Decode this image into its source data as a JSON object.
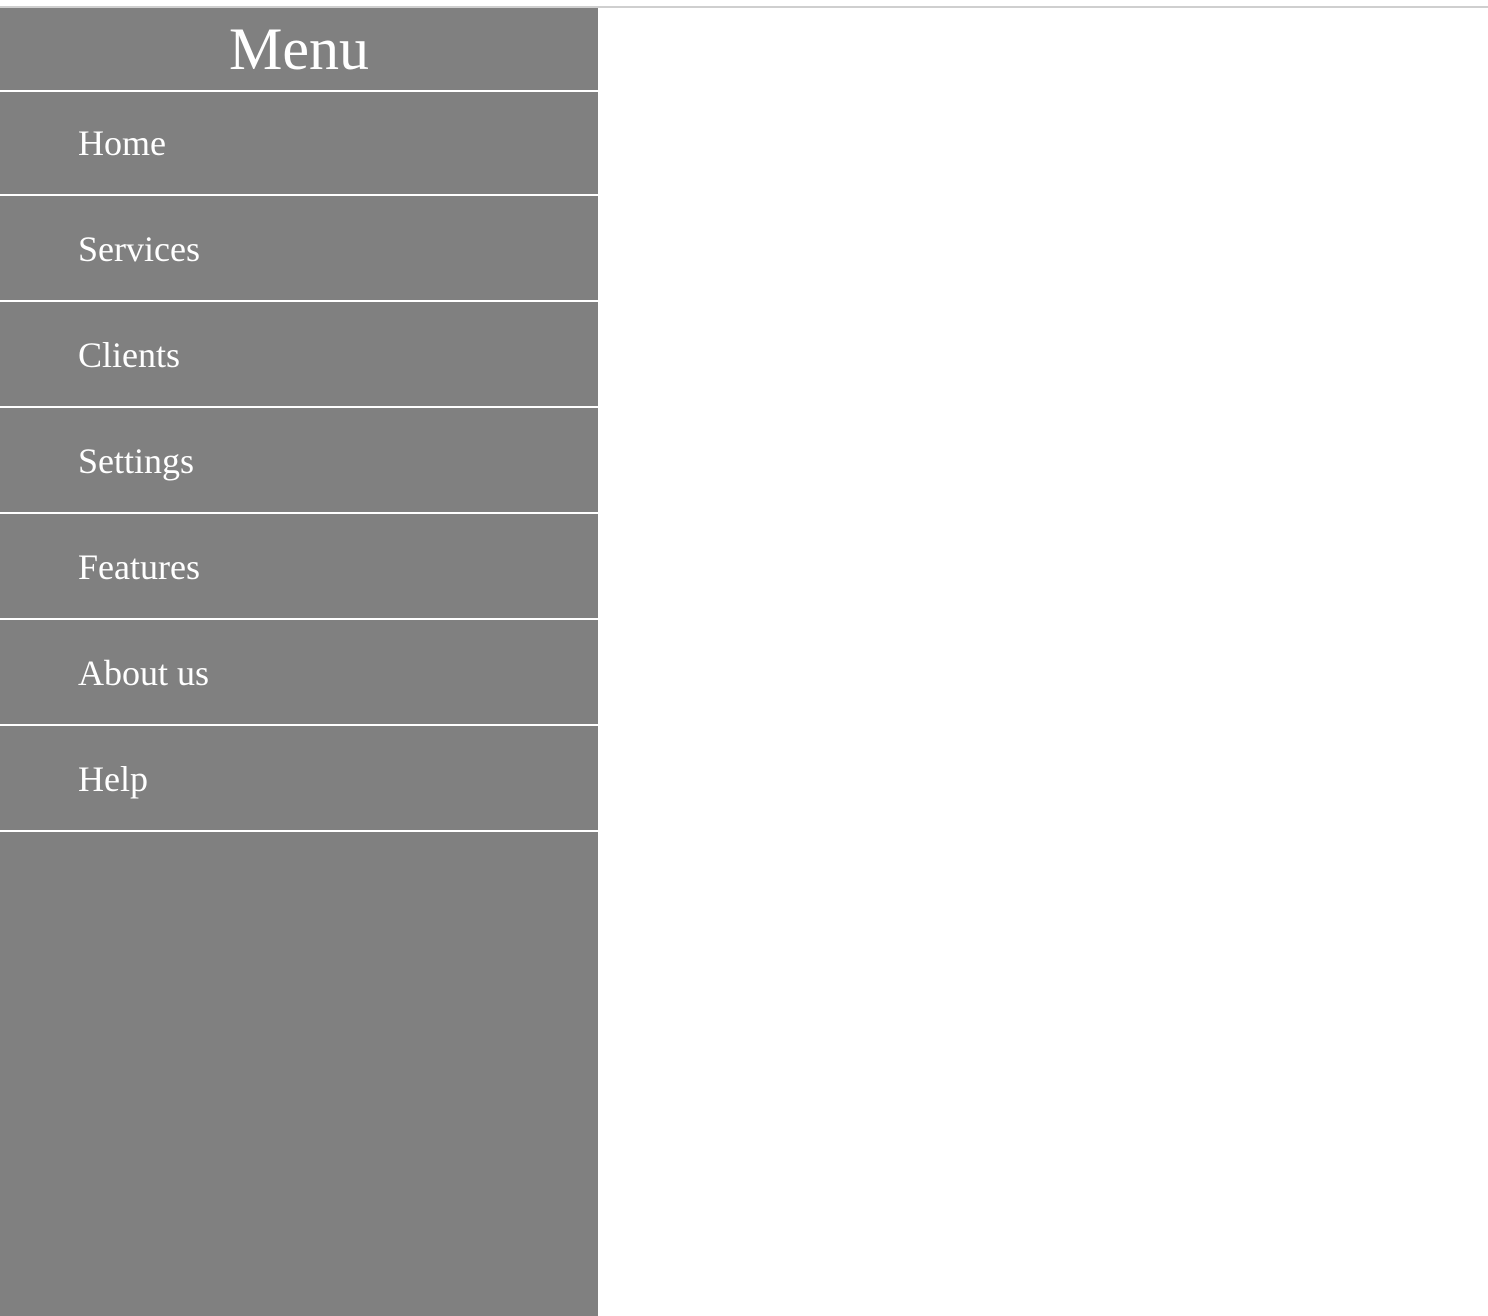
{
  "colors": {
    "sidebar_background": "#808080",
    "text": "#ffffff",
    "divider": "#ffffff",
    "page_background": "#ffffff",
    "top_rule": "#cfcfcf"
  },
  "sidebar": {
    "title": "Menu",
    "items": [
      {
        "label": "Home"
      },
      {
        "label": "Services"
      },
      {
        "label": "Clients"
      },
      {
        "label": "Settings"
      },
      {
        "label": "Features"
      },
      {
        "label": "About us"
      },
      {
        "label": "Help"
      }
    ]
  }
}
